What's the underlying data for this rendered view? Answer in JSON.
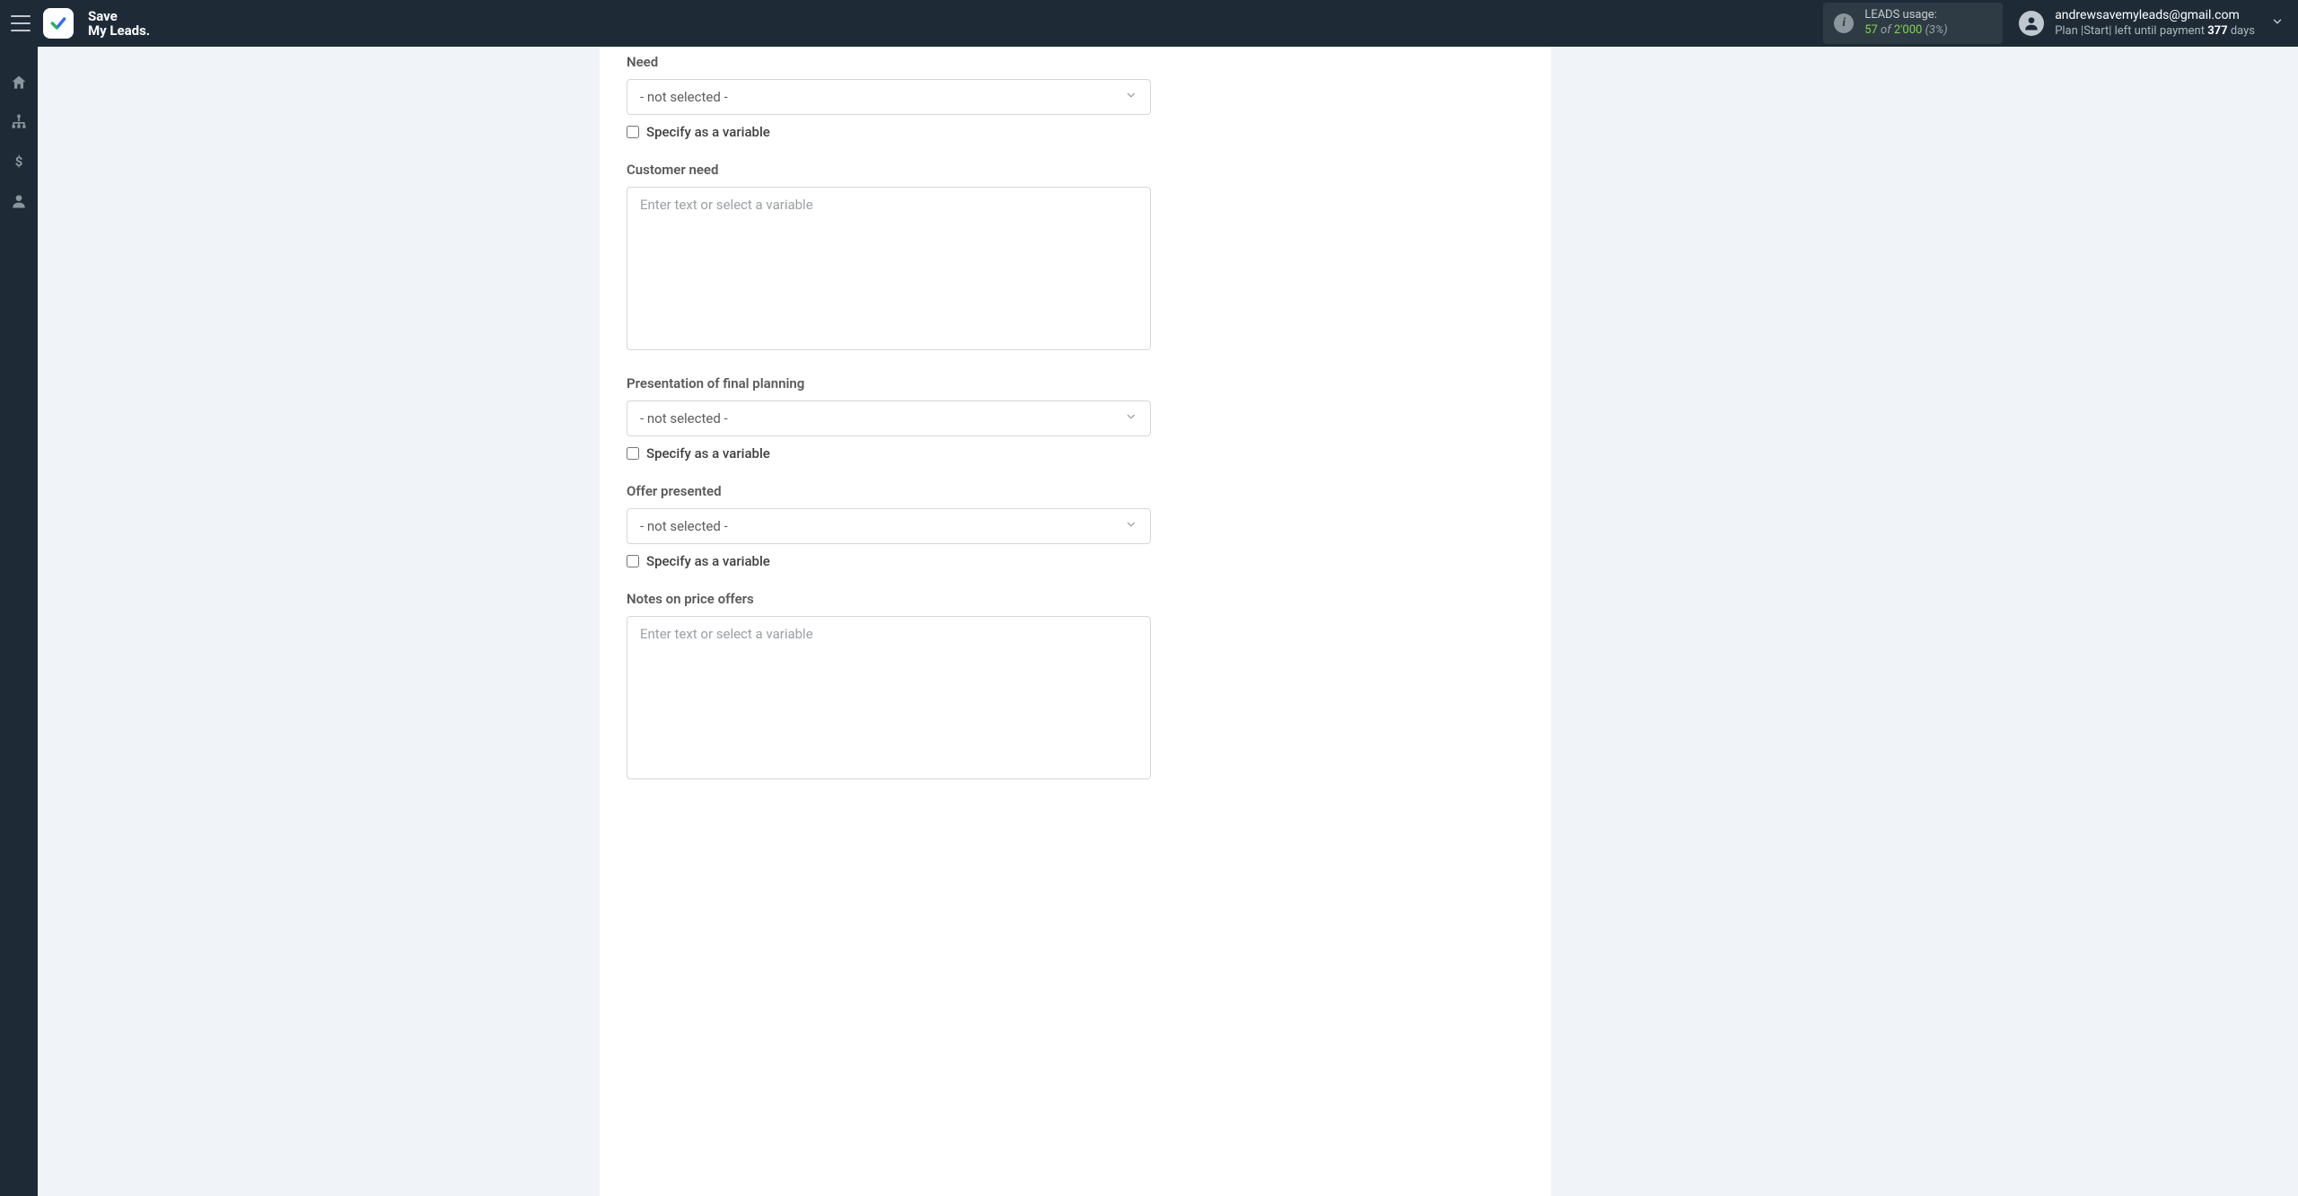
{
  "brand": {
    "line1": "Save",
    "line2": "My Leads."
  },
  "usage": {
    "label": "LEADS usage:",
    "used": "57",
    "of_word": "of",
    "total": "2'000",
    "percent": "(3%)"
  },
  "user": {
    "email": "andrewsavemyleads@gmail.com",
    "plan_prefix": "Plan |Start| left until payment ",
    "days_value": "377",
    "days_suffix": " days"
  },
  "form": {
    "need": {
      "label": "Need",
      "value": "- not selected -",
      "specify_label": "Specify as a variable"
    },
    "customer_need": {
      "label": "Customer need",
      "placeholder": "Enter text or select a variable"
    },
    "presentation": {
      "label": "Presentation of final planning",
      "value": "- not selected -",
      "specify_label": "Specify as a variable"
    },
    "offer_presented": {
      "label": "Offer presented",
      "value": "- not selected -",
      "specify_label": "Specify as a variable"
    },
    "notes_price": {
      "label": "Notes on price offers",
      "placeholder": "Enter text or select a variable"
    }
  }
}
